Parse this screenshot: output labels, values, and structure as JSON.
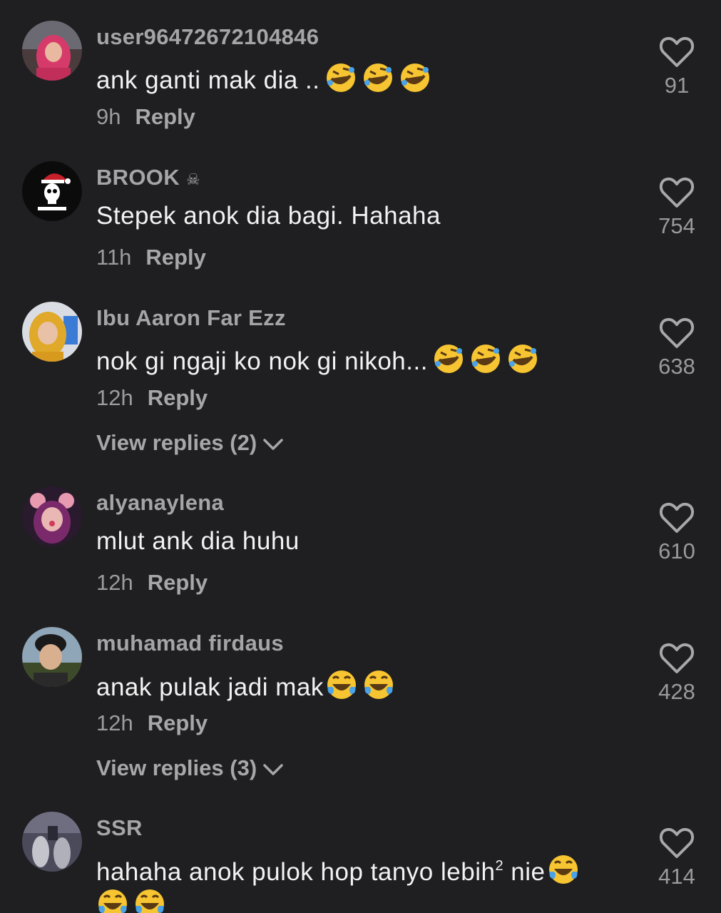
{
  "comments": [
    {
      "username": "user96472672104846",
      "text": "ank ganti mak dia ..",
      "emojis": [
        "rolling-laughing-emoji",
        "rolling-laughing-emoji",
        "rolling-laughing-emoji"
      ],
      "time": "9h",
      "reply_label": "Reply",
      "likes": "91",
      "avatar": "avatar-pink-hijab"
    },
    {
      "username": "BROOK",
      "username_suffix": "☠",
      "text": "Stepek anok dia bagi. Hahaha",
      "time": "11h",
      "reply_label": "Reply",
      "likes": "754",
      "avatar": "avatar-skull-santa-hat"
    },
    {
      "username": "Ibu Aaron Far Ezz",
      "text": "nok gi ngaji ko nok gi nikoh...",
      "emojis": [
        "rolling-laughing-emoji",
        "rolling-laughing-emoji",
        "rolling-laughing-emoji"
      ],
      "time": "12h",
      "reply_label": "Reply",
      "likes": "638",
      "view_replies": "View replies (2)",
      "avatar": "avatar-yellow-hijab"
    },
    {
      "username": "alyanaylena",
      "text": "mlut ank dia huhu",
      "time": "12h",
      "reply_label": "Reply",
      "likes": "610",
      "avatar": "avatar-mouse-ears"
    },
    {
      "username": "muhamad firdaus",
      "text": "anak pulak jadi mak",
      "emojis": [
        "tears-of-joy-emoji",
        "tears-of-joy-emoji"
      ],
      "time": "12h",
      "reply_label": "Reply",
      "likes": "428",
      "view_replies": "View replies (3)",
      "avatar": "avatar-boy-cap"
    },
    {
      "username": "SSR",
      "text": "hahaha anok pulok hop tanyo lebih",
      "superscript": "2",
      "text_after": " nie",
      "emojis": [
        "tears-of-joy-emoji"
      ],
      "emojis_line2": [
        "tears-of-joy-emoji",
        "tears-of-joy-emoji"
      ],
      "likes": "414",
      "avatar": "avatar-grey-scene"
    }
  ],
  "colors": {
    "background": "#1f1f21",
    "primary_text": "#f2f2f2",
    "secondary_text": "#a5a5a8",
    "emoji_yellow": "#f7c531",
    "tear_blue": "#4aa3e8"
  }
}
